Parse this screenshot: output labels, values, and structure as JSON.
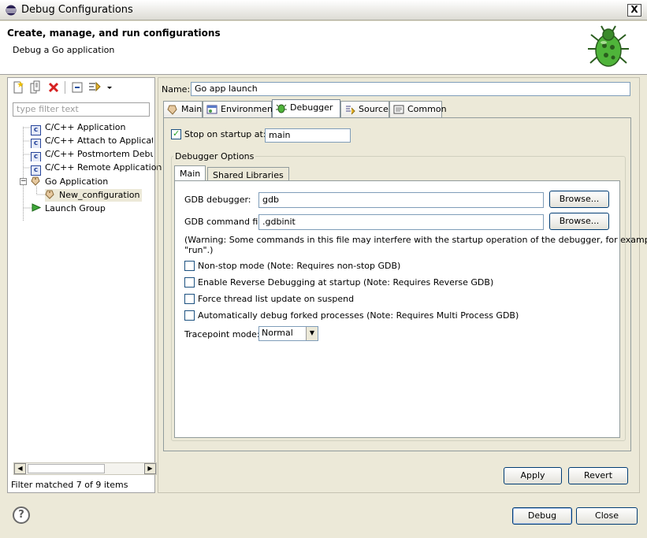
{
  "window": {
    "title": "Debug Configurations",
    "close_glyph": "X"
  },
  "header": {
    "title": "Create, manage, and run configurations",
    "subtitle": "Debug a Go application"
  },
  "left": {
    "filter_placeholder": "type filter text",
    "tree": [
      {
        "label": "C/C++ Application",
        "icon": "c-icon"
      },
      {
        "label": "C/C++ Attach to Application",
        "icon": "c-icon"
      },
      {
        "label": "C/C++ Postmortem Debugger",
        "icon": "c-icon"
      },
      {
        "label": "C/C++ Remote Application",
        "icon": "c-icon"
      },
      {
        "label": "Go Application",
        "icon": "go-tag-icon"
      },
      {
        "label": "New_configuration",
        "icon": "go-tag-icon"
      },
      {
        "label": "Launch Group",
        "icon": "launch-arrow-icon"
      }
    ],
    "collapse_glyph": "−",
    "status": "Filter matched 7 of 9 items"
  },
  "name": {
    "label": "Name:",
    "value": "Go app launch"
  },
  "tabs": [
    "Main",
    "Environment",
    "Debugger",
    "Source",
    "Common"
  ],
  "debugger": {
    "stop_on_startup_label": "Stop on startup at:",
    "stop_on_startup_checked": true,
    "stop_on_startup_value": "main",
    "options_group": "Debugger Options",
    "subtabs": [
      "Main",
      "Shared Libraries"
    ],
    "gdb_debugger_label": "GDB debugger:",
    "gdb_debugger_value": "gdb",
    "gdb_command_file_label": "GDB command file:",
    "gdb_command_file_value": ".gdbinit",
    "browse_label": "Browse...",
    "warning_line1": "(Warning: Some commands in this file may interfere with the startup operation of the debugger, for example",
    "warning_line2": "\"run\".)",
    "checkboxes": [
      "Non-stop mode (Note: Requires non-stop GDB)",
      "Enable Reverse Debugging at startup (Note: Requires Reverse GDB)",
      "Force thread list update on suspend",
      "Automatically debug forked processes (Note: Requires Multi Process GDB)"
    ],
    "tracepoint_label": "Tracepoint mode:",
    "tracepoint_value": "Normal"
  },
  "buttons": {
    "apply": "Apply",
    "revert": "Revert",
    "debug": "Debug",
    "close": "Close",
    "help_glyph": "?"
  },
  "colors": {
    "bug_green": "#4fb43a",
    "delete_red": "#d62020"
  }
}
